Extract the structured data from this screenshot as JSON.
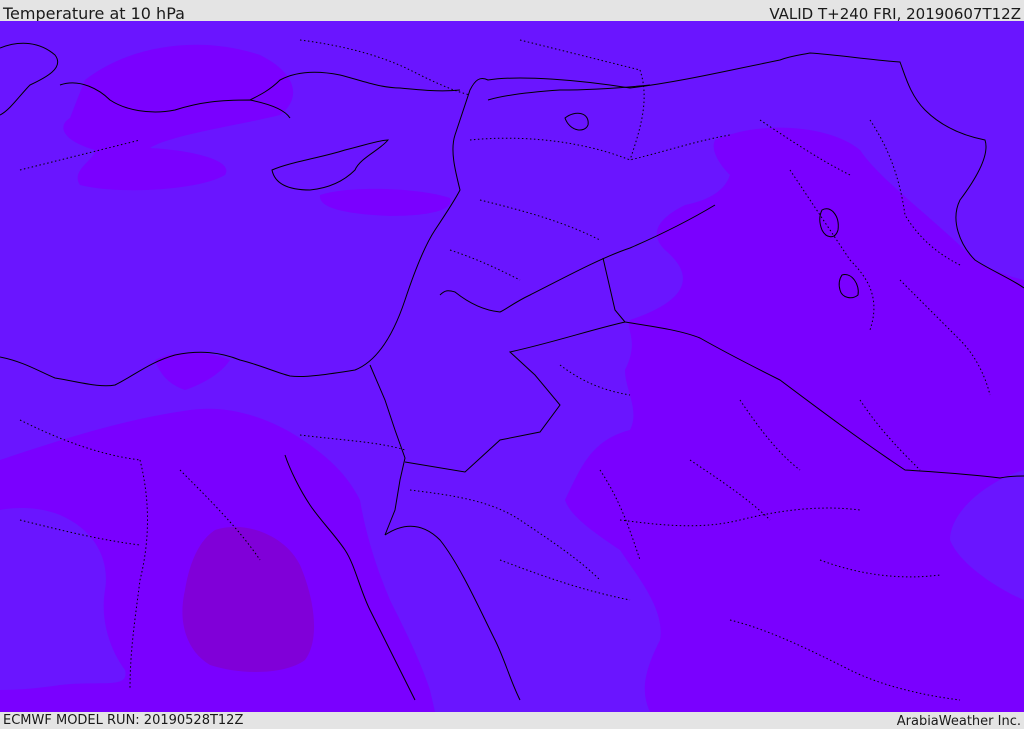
{
  "header": {
    "title": "Temperature at 10 hPa",
    "valid": "VALID T+240 FRI, 20190607T12Z"
  },
  "footer": {
    "model_run": "ECMWF MODEL RUN: 20190528T12Z",
    "credit": "ArabiaWeather Inc."
  },
  "colors": {
    "background_shade": "#6a15ff",
    "warm_shade": "#7a00ff",
    "warmest_shade": "#8000d8",
    "coastline": "#000000",
    "border": "#000000"
  },
  "map": {
    "region": "Eastern Mediterranean / Middle East",
    "variable": "Temperature",
    "level": "10 hPa"
  }
}
